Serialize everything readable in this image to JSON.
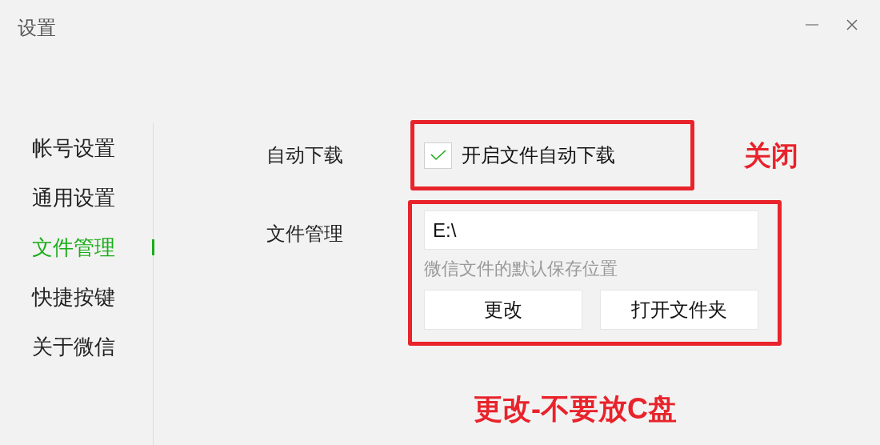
{
  "window": {
    "title": "设置",
    "controls": [
      {
        "kind": "minimize"
      },
      {
        "kind": "close"
      }
    ]
  },
  "sidebar": {
    "items": [
      {
        "label": "帐号设置",
        "selected": false
      },
      {
        "label": "通用设置",
        "selected": false
      },
      {
        "label": "文件管理",
        "selected": true
      },
      {
        "label": "快捷按键",
        "selected": false
      },
      {
        "label": "关于微信",
        "selected": false
      }
    ]
  },
  "auto_download": {
    "label": "自动下载",
    "checkbox": {
      "label": "开启文件自动下载",
      "checked": true
    }
  },
  "file_management": {
    "label": "文件管理",
    "path": {
      "value": "E:\\"
    },
    "hint": "微信文件的默认保存位置",
    "buttons": [
      "更改",
      "打开文件夹"
    ]
  },
  "annotations": [
    "关闭",
    "更改-不要放C盘"
  ]
}
